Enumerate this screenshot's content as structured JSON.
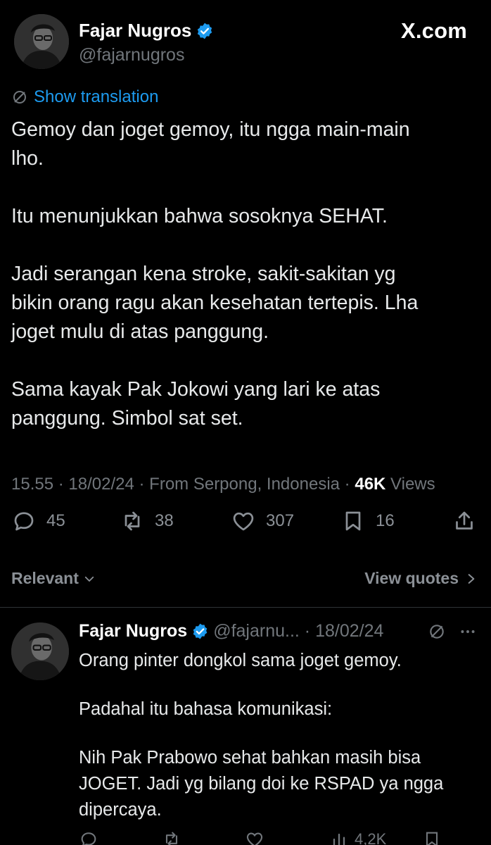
{
  "header": {
    "display_name": "Fajar Nugros",
    "handle": "@fajarnugros",
    "brand": "X.com"
  },
  "translate_label": "Show translation",
  "tweet": {
    "lines": [
      "Gemoy dan joget gemoy, itu ngga main-main",
      "lho.",
      "",
      "Itu menunjukkan bahwa sosoknya SEHAT.",
      "",
      "Jadi serangan kena stroke, sakit-sakitan yg",
      "bikin orang ragu akan kesehatan tertepis. Lha",
      "joget mulu di atas panggung.",
      "",
      "Sama kayak Pak Jokowi yang lari ke atas",
      "panggung. Simbol sat set."
    ]
  },
  "meta": {
    "time": "15.55",
    "date": "18/02/24",
    "location": "From Serpong, Indonesia",
    "views_count": "46K",
    "views_label": "Views"
  },
  "actions": {
    "replies": "45",
    "reposts": "38",
    "likes": "307",
    "bookmarks": "16"
  },
  "sort": {
    "relevant_label": "Relevant",
    "view_quotes_label": "View quotes"
  },
  "reply": {
    "display_name": "Fajar Nugros",
    "handle": "@fajarnu...",
    "date": "18/02/24",
    "lines": [
      "Orang pinter dongkol sama joget gemoy.",
      "",
      "Padahal itu bahasa komunikasi:",
      "",
      "Nih Pak Prabowo sehat bahkan masih bisa",
      "JOGET. Jadi yg bilang doi ke RSPAD ya ngga",
      "dipercaya."
    ],
    "views": "4,2K"
  },
  "colors": {
    "background": "#000000",
    "text": "#e7e9ea",
    "muted": "#71767b",
    "accent": "#1d9bf0"
  }
}
